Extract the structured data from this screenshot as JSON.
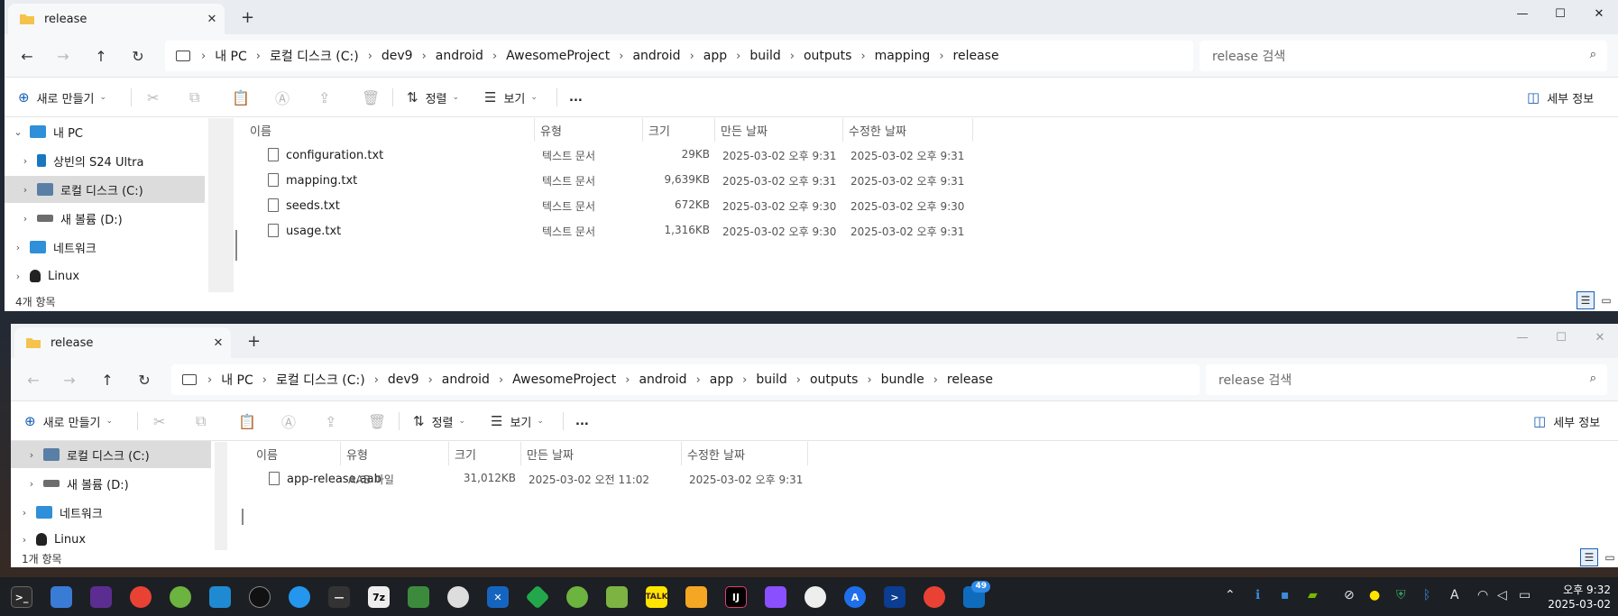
{
  "window1": {
    "tab_title": "release",
    "address": [
      "내 PC",
      "로컬 디스크 (C:)",
      "dev9",
      "android",
      "AwesomeProject",
      "android",
      "app",
      "build",
      "outputs",
      "mapping",
      "release"
    ],
    "search_placeholder": "release 검색",
    "toolbar": {
      "new": "새로 만들기",
      "sort": "정렬",
      "view": "보기",
      "more": "...",
      "details": "세부 정보"
    },
    "tree": [
      {
        "label": "내 PC",
        "expanded": true
      },
      {
        "label": "상빈의 S24 Ultra"
      },
      {
        "label": "로컬 디스크 (C:)",
        "selected": true
      },
      {
        "label": "새 볼륨 (D:)"
      },
      {
        "label": "네트워크"
      },
      {
        "label": "Linux"
      }
    ],
    "columns": [
      "이름",
      "유형",
      "크기",
      "만든 날짜",
      "수정한 날짜"
    ],
    "files": [
      {
        "name": "configuration.txt",
        "type": "텍스트 문서",
        "size": "29KB",
        "created": "2025-03-02 오후 9:31",
        "modified": "2025-03-02 오후 9:31"
      },
      {
        "name": "mapping.txt",
        "type": "텍스트 문서",
        "size": "9,639KB",
        "created": "2025-03-02 오후 9:31",
        "modified": "2025-03-02 오후 9:31"
      },
      {
        "name": "seeds.txt",
        "type": "텍스트 문서",
        "size": "672KB",
        "created": "2025-03-02 오후 9:30",
        "modified": "2025-03-02 오후 9:30"
      },
      {
        "name": "usage.txt",
        "type": "텍스트 문서",
        "size": "1,316KB",
        "created": "2025-03-02 오후 9:30",
        "modified": "2025-03-02 오후 9:31"
      }
    ],
    "status": "4개 항목"
  },
  "window2": {
    "tab_title": "release",
    "address": [
      "내 PC",
      "로컬 디스크 (C:)",
      "dev9",
      "android",
      "AwesomeProject",
      "android",
      "app",
      "build",
      "outputs",
      "bundle",
      "release"
    ],
    "search_placeholder": "release 검색",
    "toolbar": {
      "new": "새로 만들기",
      "sort": "정렬",
      "view": "보기",
      "more": "...",
      "details": "세부 정보"
    },
    "tree": [
      {
        "label": "로컬 디스크 (C:)",
        "selected": true
      },
      {
        "label": "새 볼륨 (D:)"
      },
      {
        "label": "네트워크"
      },
      {
        "label": "Linux"
      }
    ],
    "columns": [
      "이름",
      "유형",
      "크기",
      "만든 날짜",
      "수정한 날짜"
    ],
    "files": [
      {
        "name": "app-release.aab",
        "type": "AAB 파일",
        "size": "31,012KB",
        "created": "2025-03-02 오전 11:02",
        "modified": "2025-03-02 오후 9:31"
      }
    ],
    "status": "1개 항목"
  },
  "taskbar": {
    "clock_time": "오후 9:32",
    "clock_date": "2025-03-02",
    "badge_count": "49",
    "apps": [
      "terminal-icon",
      "explorer-icon",
      "vs-icon",
      "chrome-icon",
      "spring-icon",
      "vscode-icon",
      "penguin-icon",
      "docker-icon",
      "dash-icon",
      "7zip-icon",
      "media-icon",
      "proxy-icon",
      "cross-icon",
      "diamond-icon",
      "leaf-icon",
      "notepad-icon",
      "kakaotalk-icon",
      "files-icon",
      "intellij-icon",
      "git-icon",
      "github-icon",
      "appstore-icon",
      "powershell-icon",
      "chrome-profile-icon",
      "outlook-icon"
    ]
  }
}
